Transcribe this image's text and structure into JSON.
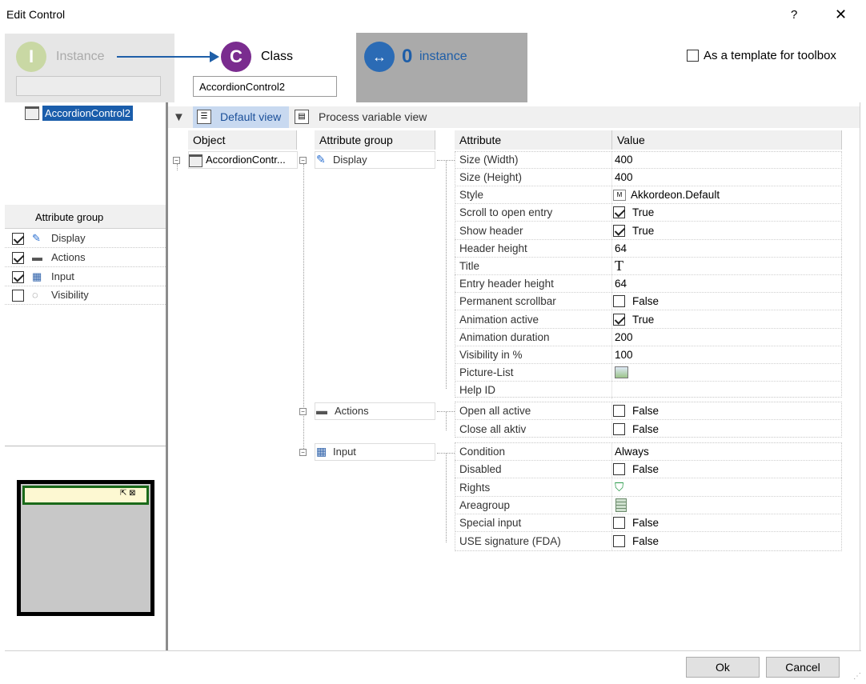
{
  "window": {
    "title": "Edit Control",
    "help_glyph": "?",
    "close_glyph": "✕"
  },
  "header": {
    "instance_letter": "I",
    "instance_label": "Instance",
    "class_letter": "C",
    "class_label": "Class",
    "class_value": "AccordionControl2",
    "instance_count": "0",
    "instance_count_label": "instance",
    "template_label": "As a template for toolbox",
    "template_checked": false
  },
  "left": {
    "object_tree_item": "AccordionControl2",
    "attribute_group_header": "Attribute group",
    "groups": [
      {
        "label": "Display",
        "checked": true,
        "icon": "pencil-icon",
        "glyph": "✎"
      },
      {
        "label": "Actions",
        "checked": true,
        "icon": "toolbox-icon",
        "glyph": "▬"
      },
      {
        "label": "Input",
        "checked": true,
        "icon": "grid-cursor-icon",
        "glyph": "▦"
      },
      {
        "label": "Visibility",
        "checked": false,
        "icon": "dotted-circle-icon",
        "glyph": "◌"
      }
    ],
    "preview_icons": "⇱ ⊠"
  },
  "toolbar": {
    "filter_glyph": "▼",
    "default_view": "Default view",
    "process_view": "Process variable view"
  },
  "columns": {
    "object": "Object",
    "attribute_group": "Attribute group",
    "attribute": "Attribute",
    "value": "Value"
  },
  "tree": {
    "object": "AccordionContr...",
    "display": "Display",
    "actions": "Actions",
    "input": "Input"
  },
  "display_attrs": [
    {
      "attr": "Size (Width)",
      "value": "400"
    },
    {
      "attr": "Size (Height)",
      "value": "400"
    },
    {
      "attr": "Style",
      "value": "Akkordeon.Default",
      "icon": "style-icon"
    },
    {
      "attr": "Scroll to open entry",
      "value": "True",
      "check": true
    },
    {
      "attr": "Show header",
      "value": "True",
      "check": true
    },
    {
      "attr": "Header height",
      "value": "64"
    },
    {
      "attr": "Title",
      "value": "T",
      "icon": "text-icon"
    },
    {
      "attr": "Entry header height",
      "value": "64"
    },
    {
      "attr": "Permanent scrollbar",
      "value": "False",
      "check": false
    },
    {
      "attr": "Animation active",
      "value": "True",
      "check": true
    },
    {
      "attr": "Animation duration",
      "value": "200"
    },
    {
      "attr": "Visibility in %",
      "value": "100"
    },
    {
      "attr": "Picture-List",
      "value": "",
      "icon": "picture-icon"
    },
    {
      "attr": "Help ID",
      "value": ""
    }
  ],
  "action_attrs": [
    {
      "attr": "Open all active",
      "value": "False",
      "check": false
    },
    {
      "attr": "Close all aktiv",
      "value": "False",
      "check": false
    }
  ],
  "input_attrs": [
    {
      "attr": "Condition",
      "value": "Always"
    },
    {
      "attr": "Disabled",
      "value": "False",
      "check": false
    },
    {
      "attr": "Rights",
      "value": "",
      "icon": "shield-icon"
    },
    {
      "attr": "Areagroup",
      "value": "",
      "icon": "building-icon"
    },
    {
      "attr": "Special input",
      "value": "False",
      "check": false
    },
    {
      "attr": "USE signature (FDA)",
      "value": "False",
      "check": false
    }
  ],
  "buttons": {
    "ok": "Ok",
    "cancel": "Cancel"
  },
  "colors": {
    "instance_circle": "#c9d8a4",
    "class_circle": "#7a2c8f",
    "count_circle": "#2b6bb5",
    "selection": "#1a5dab",
    "default_view_bg": "#c8d9f0"
  }
}
